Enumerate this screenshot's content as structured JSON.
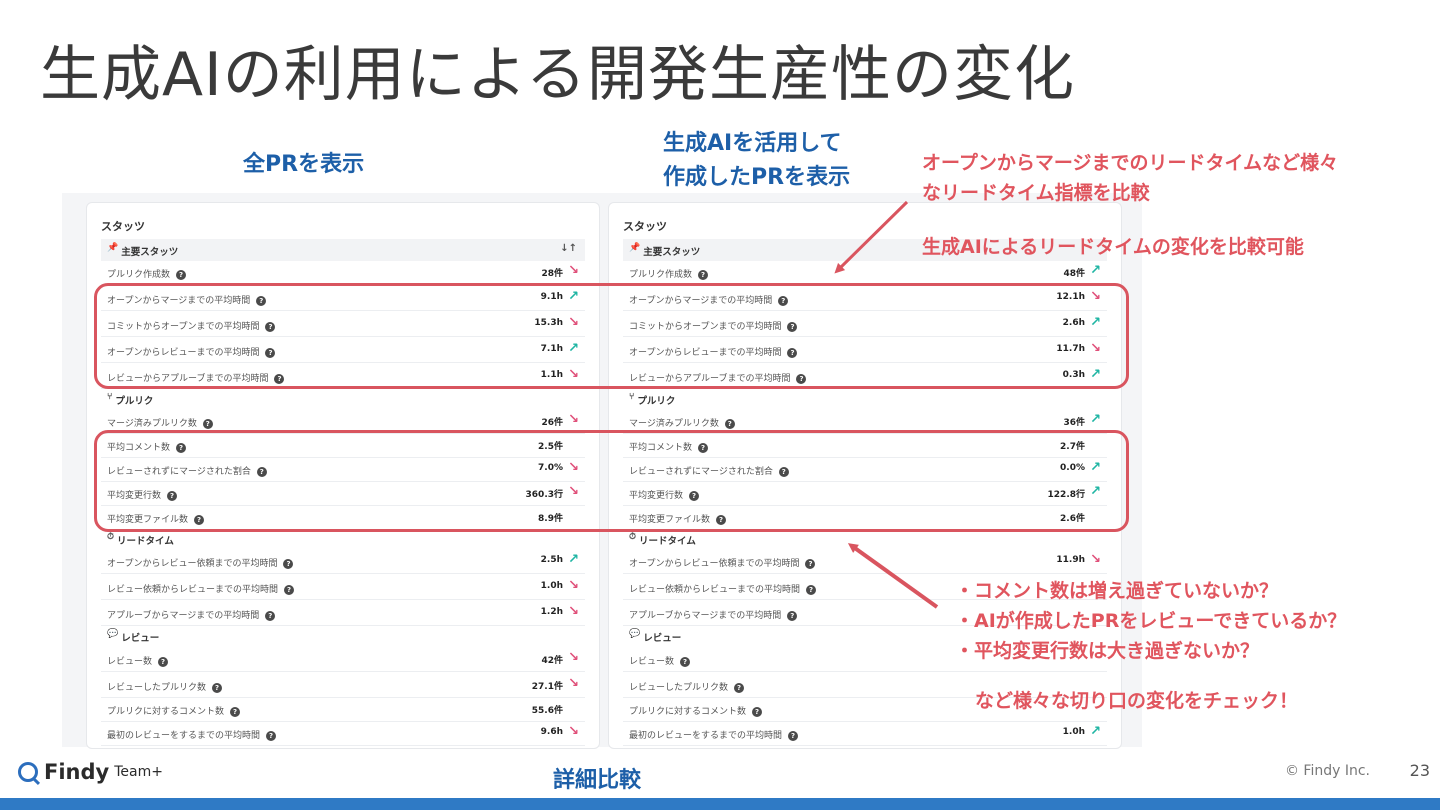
{
  "slide": {
    "title": "生成AIの利用による開発生産性の変化",
    "label_all": "全PRを表示",
    "label_ai_line1": "生成AIを活用して",
    "label_ai_line2": "作成したPRを表示",
    "note_top_line1": "オープンからマージまでのリードタイムなど様々",
    "note_top_line2": "なリードタイム指標を比較",
    "note_top_line3": "生成AIによるリードタイムの変化を比較可能",
    "note_bottom_1": "・コメント数は増え過ぎていないか？",
    "note_bottom_2": "・AIが作成したPRをレビューできているか？",
    "note_bottom_3": "・平均変更行数は大き過ぎないか？",
    "note_bottom_4": "など様々な切り口の変化をチェック！",
    "bottom_label": "詳細比較",
    "logo_name": "Findy",
    "logo_sub": "Team+",
    "copyright": "© Findy Inc.",
    "page_number": "23",
    "colors": {
      "accent_blue": "#1d5fa8",
      "note_red": "#e0555e",
      "up": "#1fb5a3",
      "down": "#e0507a"
    }
  },
  "stats_panels": {
    "heading": "スタッツ",
    "sections": {
      "main": "主要スタッツ",
      "pr": "プルリク",
      "lead": "リードタイム",
      "review": "レビュー"
    },
    "sort_icon": "↓↑",
    "rows": {
      "pr_created": "プルリク作成数",
      "open_to_merge": "オープンからマージまでの平均時間",
      "commit_to_open": "コミットからオープンまでの平均時間",
      "open_to_review": "オープンからレビューまでの平均時間",
      "review_to_approve": "レビューからアプルーブまでの平均時間",
      "merged_pr": "マージ済みプルリク数",
      "avg_comments": "平均コメント数",
      "merged_without_review": "レビューされずにマージされた割合",
      "avg_changed_lines": "平均変更行数",
      "avg_changed_files": "平均変更ファイル数",
      "open_to_review_request": "オープンからレビュー依頼までの平均時間",
      "request_to_review": "レビュー依頼からレビューまでの平均時間",
      "approve_to_merge": "アプルーブからマージまでの平均時間",
      "review_count": "レビュー数",
      "reviewed_pr": "レビューしたプルリク数",
      "comments_per_pr": "プルリクに対するコメント数",
      "time_to_first_review": "最初のレビューをするまでの平均時間"
    },
    "left": {
      "pr_created": "28件",
      "open_to_merge": "9.1h",
      "commit_to_open": "15.3h",
      "open_to_review": "7.1h",
      "review_to_approve": "1.1h",
      "merged_pr": "26件",
      "avg_comments": "2.5件",
      "merged_without_review": "7.0%",
      "avg_changed_lines": "360.3行",
      "avg_changed_files": "8.9件",
      "open_to_review_request": "2.5h",
      "request_to_review": "1.0h",
      "approve_to_merge": "1.2h",
      "review_count": "42件",
      "reviewed_pr": "27.1件",
      "comments_per_pr": "55.6件",
      "time_to_first_review": "9.6h"
    },
    "right": {
      "pr_created": "48件",
      "open_to_merge": "12.1h",
      "commit_to_open": "2.6h",
      "open_to_review": "11.7h",
      "review_to_approve": "0.3h",
      "merged_pr": "36件",
      "avg_comments": "2.7件",
      "merged_without_review": "0.0%",
      "avg_changed_lines": "122.8行",
      "avg_changed_files": "2.6件",
      "open_to_review_request": "11.9h",
      "time_to_first_review": "1.0h"
    }
  }
}
